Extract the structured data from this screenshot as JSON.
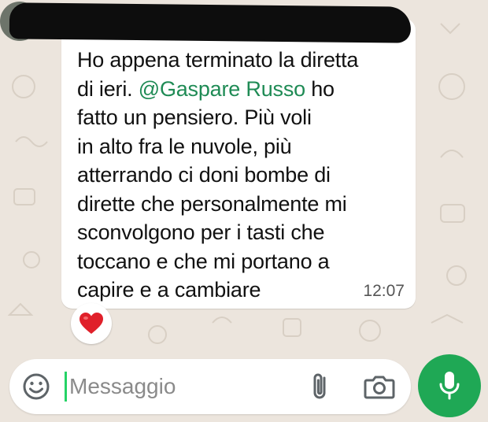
{
  "chat": {
    "message": {
      "text_before": "Ho appena terminato la diretta\ndi ieri. ",
      "mention": "@Gaspare Russo",
      "text_after": " ho\nfatto un pensiero. Più voli\nin alto fra le nuvole, più\natterrando ci doni bombe di\ndirette che personalmente mi\nsconvolgono per i tasti che\ntoccano e che mi portano a\ncapire e a cambiare",
      "time": "12:07",
      "reaction": "heart"
    },
    "sender_name_redacted": true
  },
  "composer": {
    "placeholder": "Messaggio",
    "emoji_icon": "smiley-icon",
    "attach_icon": "paperclip-icon",
    "camera_icon": "camera-icon",
    "send_icon": "microphone-icon"
  },
  "colors": {
    "accent": "#1fa855",
    "mention": "#1f8b55",
    "wallpaper": "#ece5dd",
    "reaction": "#e0202a"
  }
}
